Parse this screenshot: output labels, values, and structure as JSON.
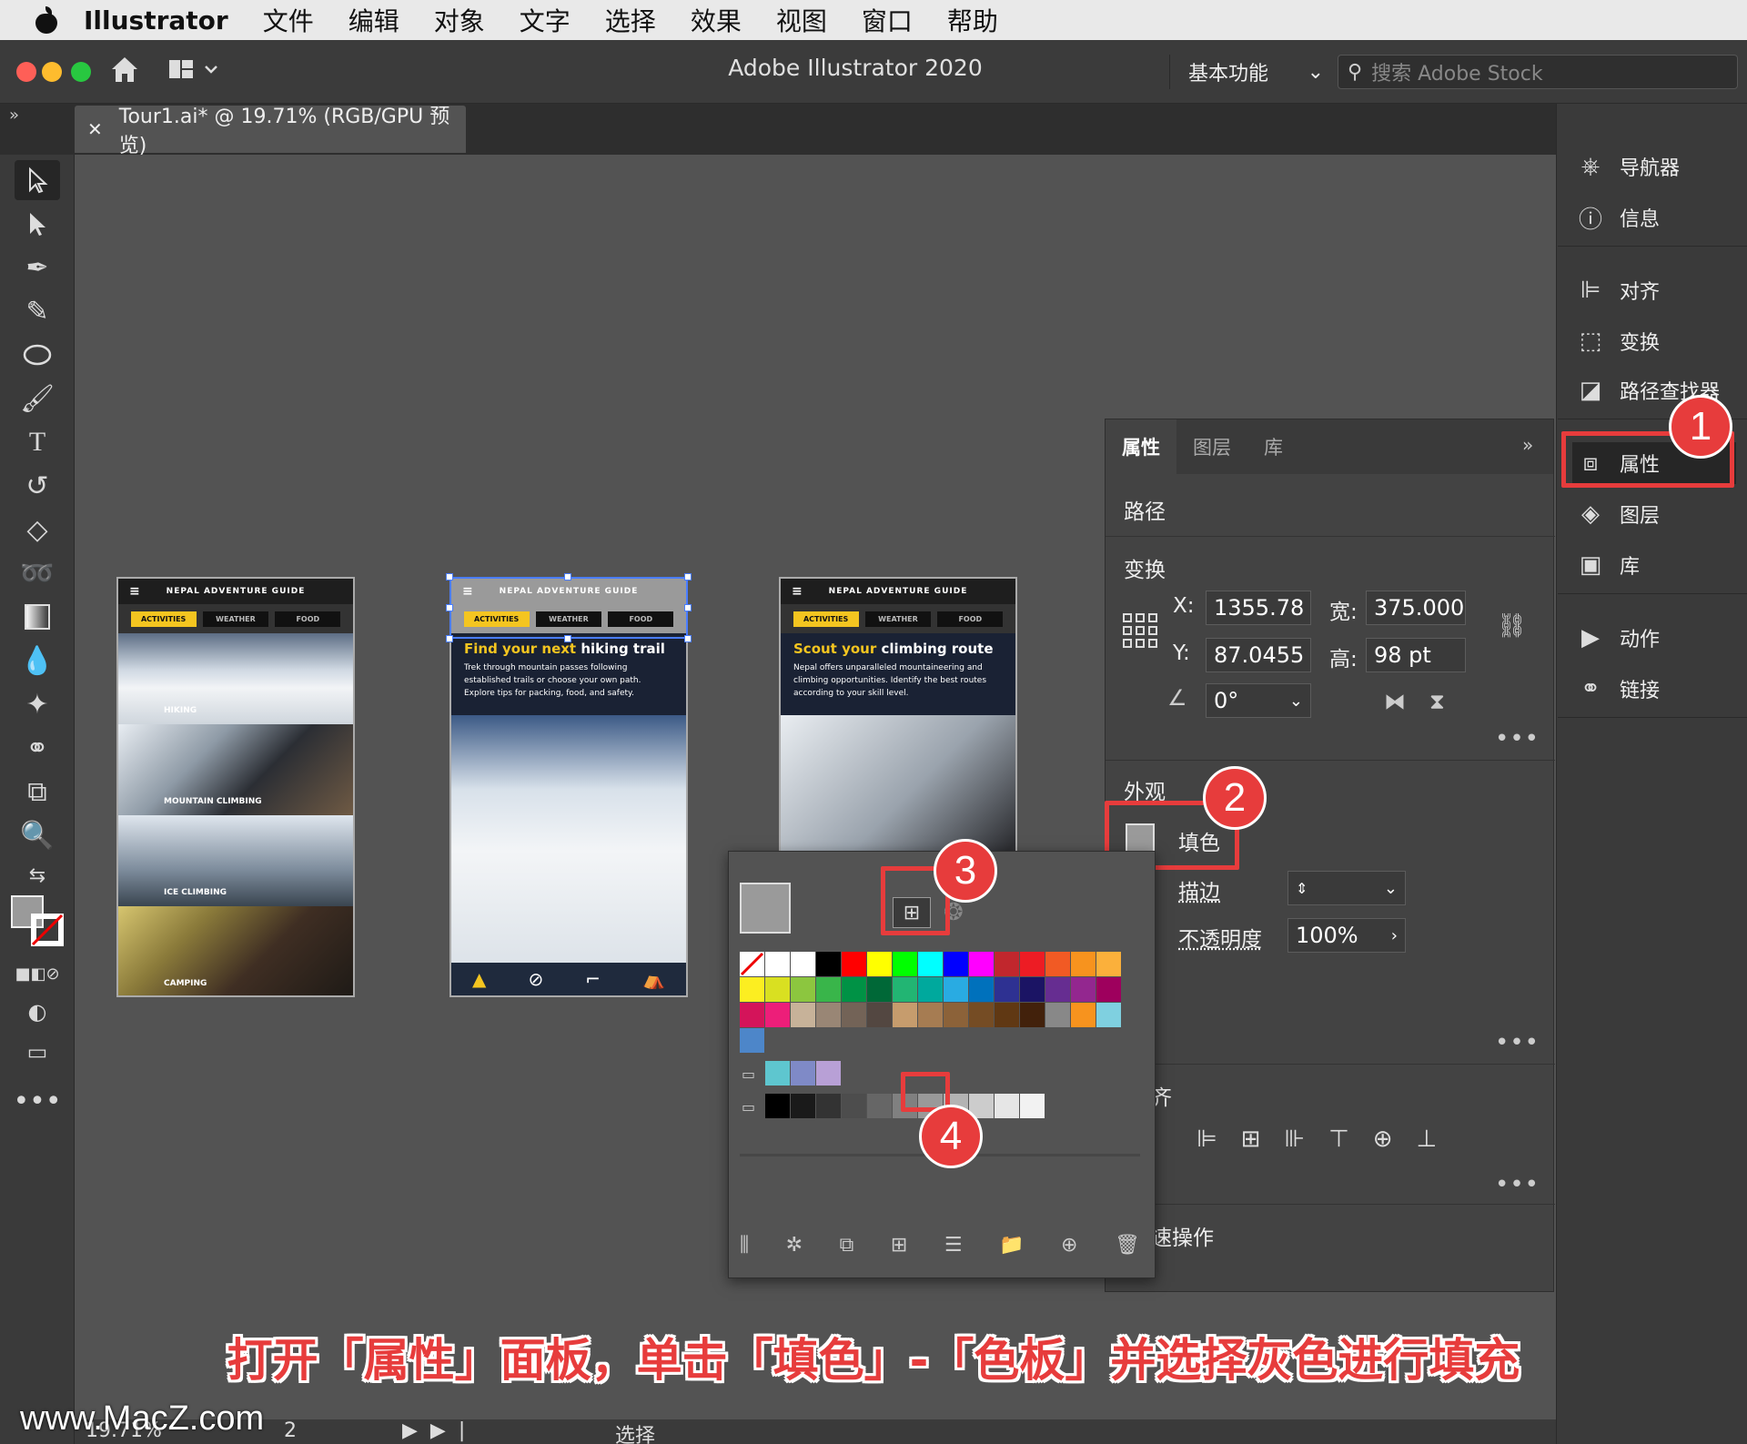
{
  "menubar": {
    "app": "Illustrator",
    "items": [
      "文件",
      "编辑",
      "对象",
      "文字",
      "选择",
      "效果",
      "视图",
      "窗口",
      "帮助"
    ]
  },
  "titlebar": {
    "title": "Adobe Illustrator 2020",
    "workspace": "基本功能",
    "stock_placeholder": "搜索 Adobe Stock"
  },
  "document": {
    "tab_label": "Tour1.ai* @ 19.71% (RGB/GPU 预览)"
  },
  "dock": {
    "group1": [
      "导航器",
      "信息"
    ],
    "group2": [
      "对齐",
      "变换",
      "路径查找器"
    ],
    "group3": [
      "属性",
      "图层",
      "库"
    ],
    "group4": [
      "动作",
      "链接"
    ]
  },
  "artboards": {
    "header": "NEPAL ADVENTURE GUIDE",
    "tabs": [
      "ACTIVITIES",
      "WEATHER",
      "FOOD"
    ],
    "categories": [
      "HIKING",
      "MOUNTAIN CLIMBING",
      "ICE CLIMBING",
      "CAMPING"
    ],
    "hiking": {
      "title_a": "Find your next ",
      "title_b": "hiking trail",
      "body": "Trek through mountain passes following established trails or choose your own path. Explore tips for packing, food, and safety."
    },
    "climbing": {
      "title_a": "Scout your ",
      "title_b": "climbing route",
      "body": "Nepal offers unparalleled mountaineering and climbing opportunities. Identify the best routes according to your skill level."
    }
  },
  "properties": {
    "tabs": [
      "属性",
      "图层",
      "库"
    ],
    "section_path": "路径",
    "section_transform": "变换",
    "x_label": "X:",
    "x_value": "1355.78",
    "y_label": "Y:",
    "y_value": "87.0455",
    "w_label": "宽:",
    "w_value": "375.000",
    "h_label": "高:",
    "h_value": "98 pt",
    "angle_value": "0°",
    "section_appearance": "外观",
    "fill_label": "填色",
    "stroke_label": "描边",
    "opacity_label": "不透明度",
    "opacity_value": "100%",
    "align_partial": "齐",
    "quick_partial": "速操作"
  },
  "badges": [
    "1",
    "2",
    "3",
    "4"
  ],
  "caption": "打开「属性」面板，单击「填色」-「色板」并选择灰色进行填充",
  "status": {
    "zoom": "19.71%",
    "artboard": "2",
    "tool": "选择"
  },
  "watermark": "www.MacZ.com",
  "colors": {
    "accent": "#e73c3c",
    "yellow": "#f4c520"
  }
}
